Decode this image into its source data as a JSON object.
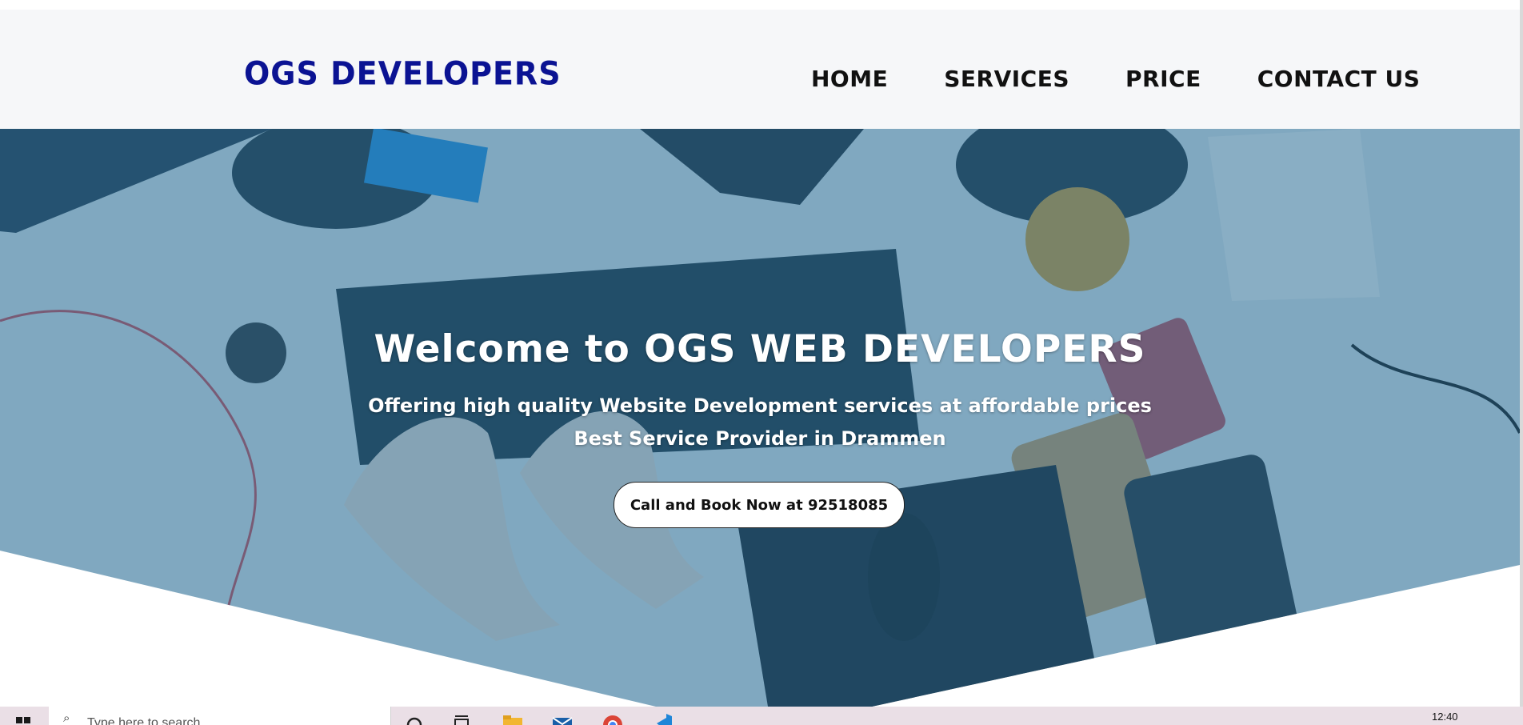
{
  "brand": {
    "logo_text": "OGS DEVELOPERS"
  },
  "nav": {
    "items": [
      {
        "label": "HOME"
      },
      {
        "label": "SERVICES"
      },
      {
        "label": "PRICE"
      },
      {
        "label": "CONTACT US"
      }
    ]
  },
  "hero": {
    "title": "Welcome to OGS WEB DEVELOPERS",
    "subtitle_line1": "Offering high quality Website Development services at affordable prices",
    "subtitle_line2": "Best Service Provider in Drammen",
    "cta_label": "Call and Book Now at 92518085"
  },
  "taskbar": {
    "search_placeholder": "Type here to search",
    "clock_time": "12:40",
    "icons": [
      "windows-start-icon",
      "search-icon",
      "cortana-icon",
      "task-view-icon",
      "file-explorer-icon",
      "mail-icon",
      "chrome-icon",
      "vscode-icon"
    ]
  },
  "colors": {
    "logo": "#0b1393",
    "header_bg": "#f6f7f9",
    "hero_overlay": "#2a6f9a",
    "taskbar_bg": "#eadfe6"
  }
}
